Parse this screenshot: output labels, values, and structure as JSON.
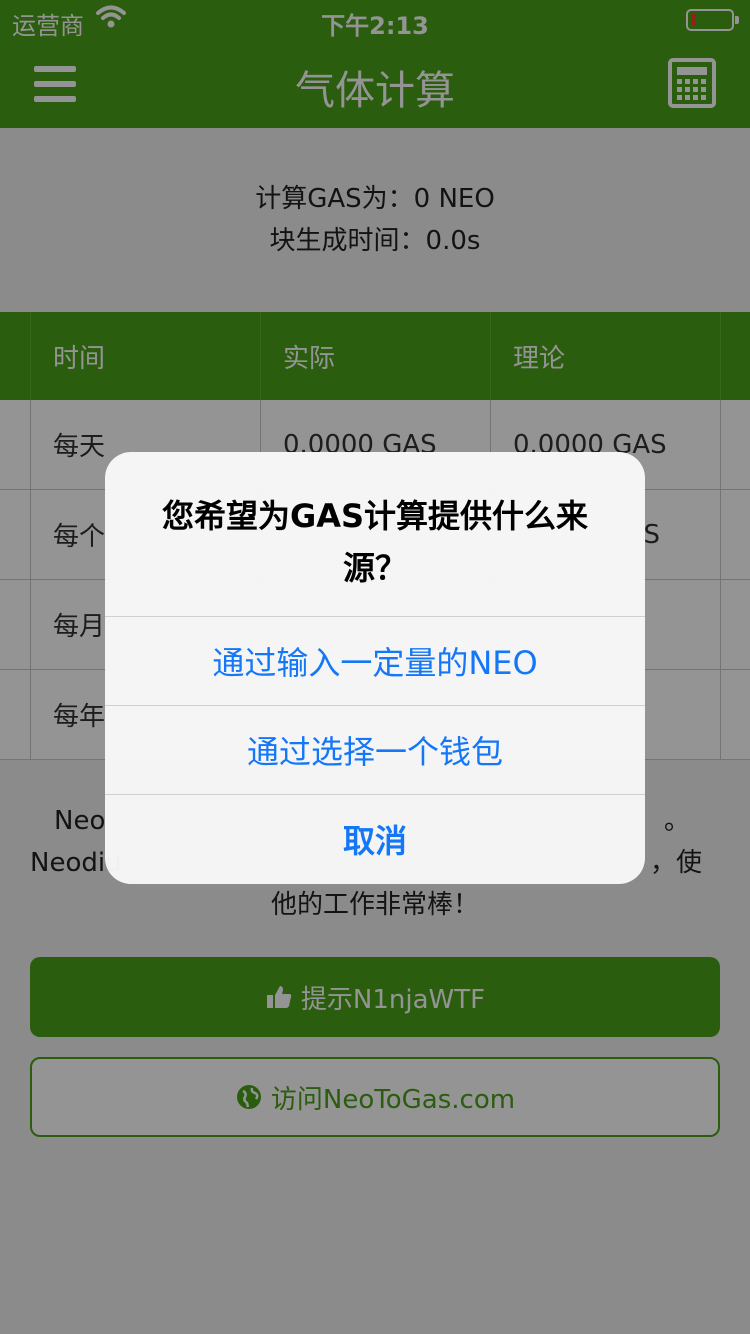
{
  "status_bar": {
    "carrier": "运营商",
    "time": "下午2:13"
  },
  "nav": {
    "title": "气体计算"
  },
  "summary": {
    "line1": "计算GAS为：0 NEO",
    "line2": "块生成时间：0.0s"
  },
  "table": {
    "headers": [
      "时间",
      "实际",
      "理论"
    ],
    "rows": [
      [
        "每天",
        "0.0000 GAS",
        "0.0000 GAS"
      ],
      [
        "每个",
        "",
        "S"
      ],
      [
        "每月",
        "",
        ""
      ],
      [
        "每年",
        "",
        ""
      ]
    ]
  },
  "credit": {
    "line1": "Neo",
    "line2": "Neodiu",
    "line3": "他的工作非常棒！",
    "right1": "。",
    "right2": "，使"
  },
  "buttons": {
    "tip": "提示N1njaWTF",
    "visit": "访问NeoToGas.com"
  },
  "alert": {
    "title": "您希望为GAS计算提供什么来源？",
    "option1": "通过输入一定量的NEO",
    "option2": "通过选择一个钱包",
    "cancel": "取消"
  },
  "colors": {
    "brand": "#4aa01a",
    "ios_blue": "#1477f8"
  }
}
